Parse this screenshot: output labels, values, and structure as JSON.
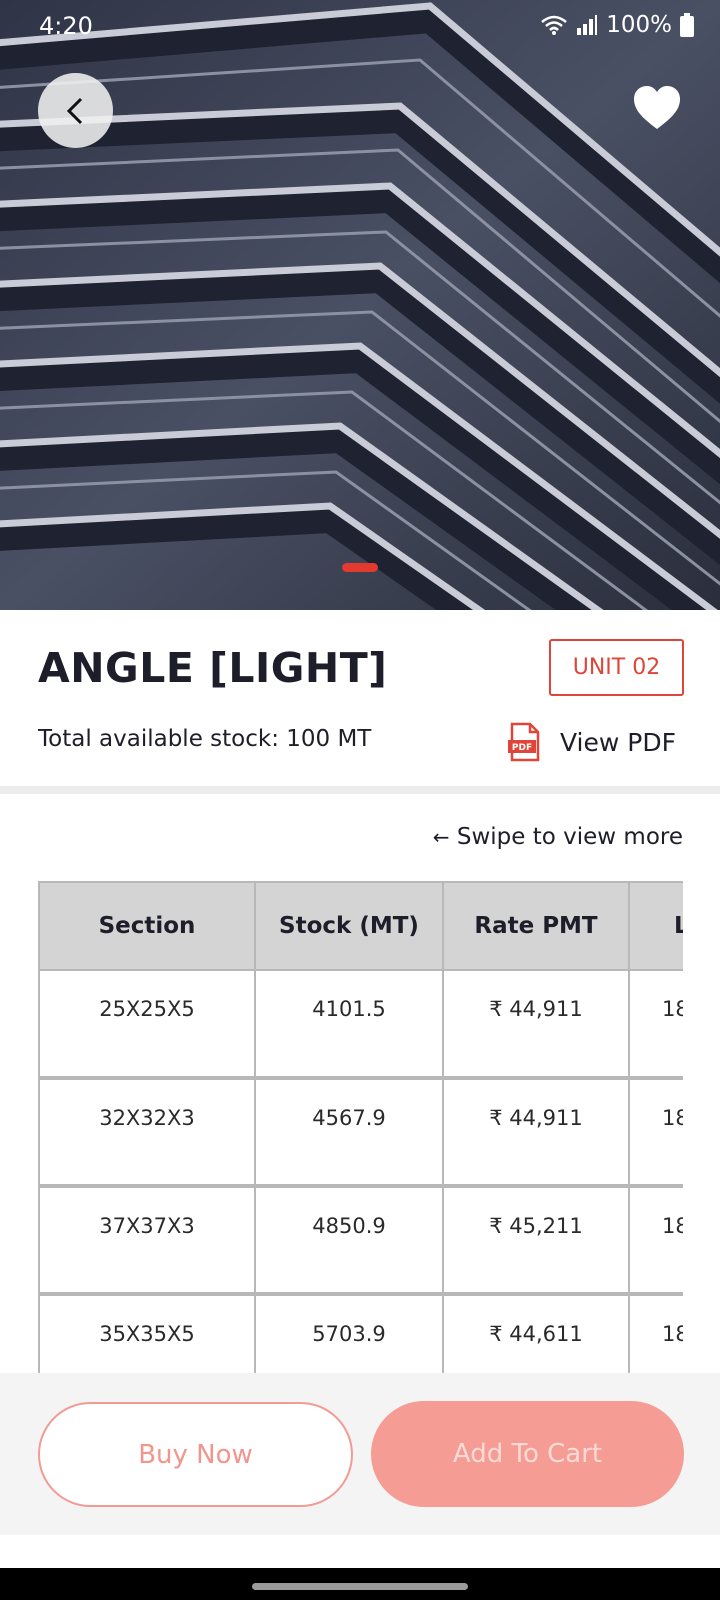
{
  "status_bar": {
    "time": "4:20",
    "battery": "100%"
  },
  "product": {
    "title": "ANGLE [LIGHT]",
    "unit_badge": "UNIT 02",
    "stock_text": "Total available stock: 100 MT",
    "pdf_icon_label": "PDF",
    "view_pdf_label": "View PDF",
    "swipe_hint": "Swipe to view more",
    "swipe_arrow": "←"
  },
  "carousel": {
    "active_index": 0
  },
  "table": {
    "headers": [
      "Section",
      "Stock (MT)",
      "Rate PMT",
      "L"
    ],
    "rows": [
      [
        "25X25X5",
        "4101.5",
        "₹ 44,911",
        "18"
      ],
      [
        "32X32X3",
        "4567.9",
        "₹ 44,911",
        "18"
      ],
      [
        "37X37X3",
        "4850.9",
        "₹ 45,211",
        "18"
      ],
      [
        "35X35X5",
        "5703.9",
        "₹ 44,611",
        "18"
      ]
    ]
  },
  "actions": {
    "buy_now": "Buy Now",
    "add_to_cart": "Add To Cart"
  },
  "colors": {
    "accent": "#e0453a",
    "button_fill": "#f59c95",
    "header_bg": "#d4d4d4"
  },
  "icons": {
    "back": "chevron-left-icon",
    "favorite": "heart-icon",
    "pdf": "pdf-file-icon",
    "wifi": "wifi-icon",
    "signal": "signal-icon",
    "battery": "battery-icon"
  }
}
